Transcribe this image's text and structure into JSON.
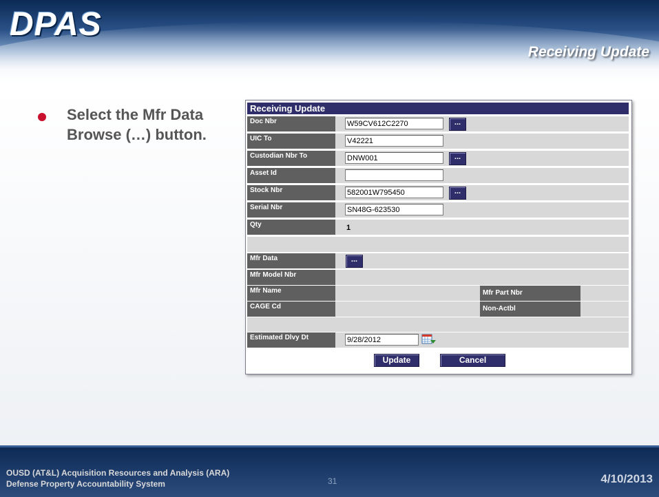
{
  "header": {
    "logo_text": "DPAS",
    "slide_title": "Receiving Update"
  },
  "instruction": {
    "text": "Select the Mfr Data Browse (…) button."
  },
  "form": {
    "title": "Receiving Update",
    "fields": {
      "doc_nbr": {
        "label": "Doc Nbr",
        "value": "W59CV612C2270"
      },
      "uic_to": {
        "label": "UIC To",
        "value": "V42221"
      },
      "custodian_nbr_to": {
        "label": "Custodian Nbr To",
        "value": "DNW001"
      },
      "asset_id": {
        "label": "Asset Id",
        "value": ""
      },
      "stock_nbr": {
        "label": "Stock Nbr",
        "value": "582001W795450"
      },
      "serial_nbr": {
        "label": "Serial Nbr",
        "value": "SN48G-623530"
      },
      "qty": {
        "label": "Qty",
        "value": "1"
      },
      "mfr_data": {
        "label": "Mfr Data"
      },
      "mfr_model_nbr": {
        "label": "Mfr Model Nbr"
      },
      "mfr_name": {
        "label": "Mfr Name"
      },
      "mfr_part_nbr": {
        "label": "Mfr Part Nbr"
      },
      "cage_cd": {
        "label": "CAGE Cd"
      },
      "non_actbl": {
        "label": "Non-Actbl"
      },
      "estimated_dlvy_dt": {
        "label": "Estimated Dlvy Dt",
        "value": "9/28/2012"
      }
    },
    "browse_label": "...",
    "calendar_icon": "calendar-icon",
    "buttons": {
      "update": "Update",
      "cancel": "Cancel"
    }
  },
  "footer": {
    "line1": "OUSD (AT&L) Acquisition Resources and Analysis (ARA)",
    "line2": "Defense Property Accountability System",
    "page": "31",
    "date": "4/10/2013"
  },
  "colors": {
    "header_navy": "#0b2a55",
    "panel_title": "#2f2e6b",
    "label_bg": "#5f5f5f",
    "bullet": "#c8102e"
  }
}
